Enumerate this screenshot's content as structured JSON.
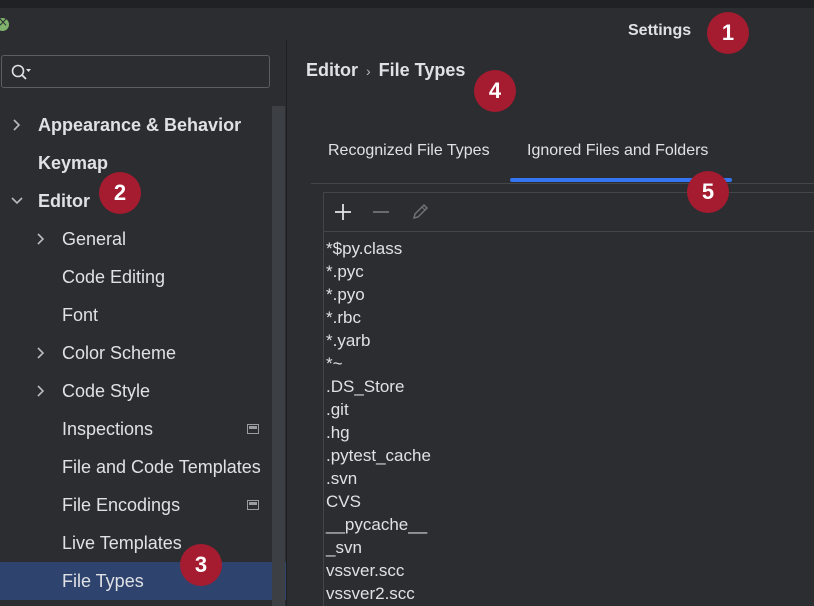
{
  "window": {
    "title": "Settings"
  },
  "search": {
    "placeholder": ""
  },
  "sidebar": {
    "items": [
      {
        "label": "Appearance & Behavior",
        "chevron": "right"
      },
      {
        "label": "Keymap",
        "chevron": ""
      },
      {
        "label": "Editor",
        "chevron": "down"
      },
      {
        "label": "General",
        "chevron": "right"
      },
      {
        "label": "Code Editing",
        "chevron": ""
      },
      {
        "label": "Font",
        "chevron": ""
      },
      {
        "label": "Color Scheme",
        "chevron": "right"
      },
      {
        "label": "Code Style",
        "chevron": "right"
      },
      {
        "label": "Inspections",
        "chevron": "",
        "icon": "project-settings-icon"
      },
      {
        "label": "File and Code Templates",
        "chevron": ""
      },
      {
        "label": "File Encodings",
        "chevron": "",
        "icon": "project-settings-icon"
      },
      {
        "label": "Live Templates",
        "chevron": ""
      },
      {
        "label": "File Types",
        "chevron": "",
        "selected": true
      }
    ]
  },
  "breadcrumb": {
    "parent": "Editor",
    "separator": "›",
    "current": "File Types"
  },
  "tabs": [
    {
      "label": "Recognized File Types",
      "active": false
    },
    {
      "label": "Ignored Files and Folders",
      "active": true
    }
  ],
  "toolbar": {
    "buttons": [
      "add-icon",
      "remove-icon",
      "edit-icon"
    ]
  },
  "ignored_items": [
    "*$py.class",
    "*.pyc",
    "*.pyo",
    "*.rbc",
    "*.yarb",
    "*~",
    ".DS_Store",
    ".git",
    ".hg",
    ".pytest_cache",
    ".svn",
    "CVS",
    "__pycache__",
    "_svn",
    "vssver.scc",
    "vssver2.scc"
  ],
  "annotations": [
    "1",
    "2",
    "3",
    "4",
    "5"
  ],
  "colors": {
    "accent": "#3574f0",
    "selection": "#2e436e",
    "badge": "#a51c30",
    "background": "#2b2d30"
  }
}
